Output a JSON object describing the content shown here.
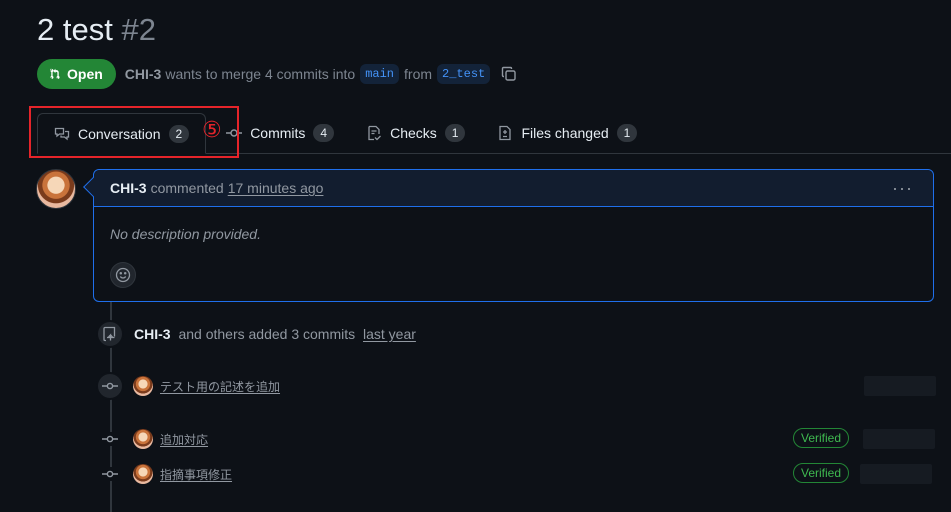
{
  "pr": {
    "title": "2 test",
    "number": "#2",
    "state": "Open",
    "author": "CHI-3",
    "merge_text": "wants to merge 4 commits into",
    "base_branch": "main",
    "from_text": "from",
    "head_branch": "2_test"
  },
  "tabs": [
    {
      "label": "Conversation",
      "count": "2",
      "icon": "comment-discussion-icon"
    },
    {
      "label": "Commits",
      "count": "4",
      "icon": "git-commit-icon"
    },
    {
      "label": "Checks",
      "count": "1",
      "icon": "checklist-icon"
    },
    {
      "label": "Files changed",
      "count": "1",
      "icon": "file-diff-icon"
    }
  ],
  "annotation": {
    "marker": "⑤",
    "color": "#e5242a"
  },
  "comment": {
    "author": "CHI-3",
    "action": "commented",
    "time": "17 minutes ago",
    "body": "No description provided.",
    "menu": "···"
  },
  "timeline": {
    "added": {
      "author": "CHI-3",
      "text": "and others added 3 commits",
      "time": "last year"
    },
    "commits": [
      {
        "message": "テスト用の記述を追加",
        "verified": ""
      },
      {
        "message": "追加対応",
        "verified": "Verified"
      },
      {
        "message": "指摘事項修正",
        "verified": "Verified"
      }
    ]
  },
  "colors": {
    "background": "#0d1117",
    "open_green": "#238636",
    "link_blue": "#4493f8",
    "verified_green": "#3fb950"
  }
}
